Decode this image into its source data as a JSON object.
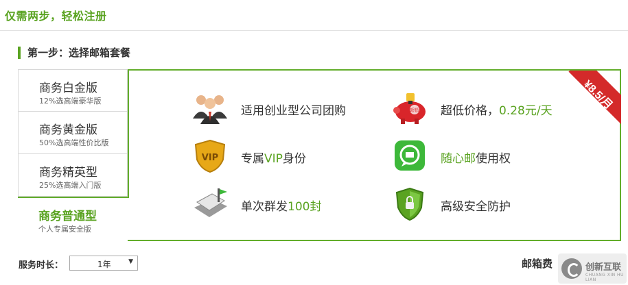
{
  "header": {
    "title": "仅需两步，轻松注册"
  },
  "step1": {
    "title": "第一步：选择邮箱套餐"
  },
  "tabs": [
    {
      "name": "商务白金版",
      "desc": "12%选高端豪华版",
      "active": false
    },
    {
      "name": "商务黄金版",
      "desc": "50%选高端性价比版",
      "active": false
    },
    {
      "name": "商务精英型",
      "desc": "25%选高端入门版",
      "active": false
    },
    {
      "name": "商务普通型",
      "desc": "个人专属安全版",
      "active": true
    }
  ],
  "features": {
    "f1": {
      "text": "适用创业型公司团购",
      "icon": "business-people-icon"
    },
    "f2": {
      "pre": "超低价格，",
      "highlight": "0.28元/天",
      "icon": "piggy-bank-icon",
      "piggy_label": "超低"
    },
    "f3": {
      "pre": "专属",
      "highlight": "VIP",
      "post": "身份",
      "icon": "vip-shield-icon",
      "badge": "VIP"
    },
    "f4": {
      "highlight": "随心邮",
      "post": "使用权",
      "icon": "chat-app-icon"
    },
    "f5": {
      "pre": "单次群发",
      "highlight": "100封",
      "icon": "mailbox-icon"
    },
    "f6": {
      "text": "高级安全防护",
      "icon": "security-shield-icon"
    }
  },
  "ribbon": {
    "price": "¥8.5/月",
    "color": "#d42a2a"
  },
  "duration": {
    "label": "服务时长：",
    "value": "1年"
  },
  "fee": {
    "label": "邮箱费"
  },
  "watermark": {
    "text": "创新互联",
    "sub": "CHUANG XIN HU LIAN"
  },
  "colors": {
    "accent": "#5aa321",
    "border": "#62ad2b",
    "ribbon": "#d42a2a"
  }
}
